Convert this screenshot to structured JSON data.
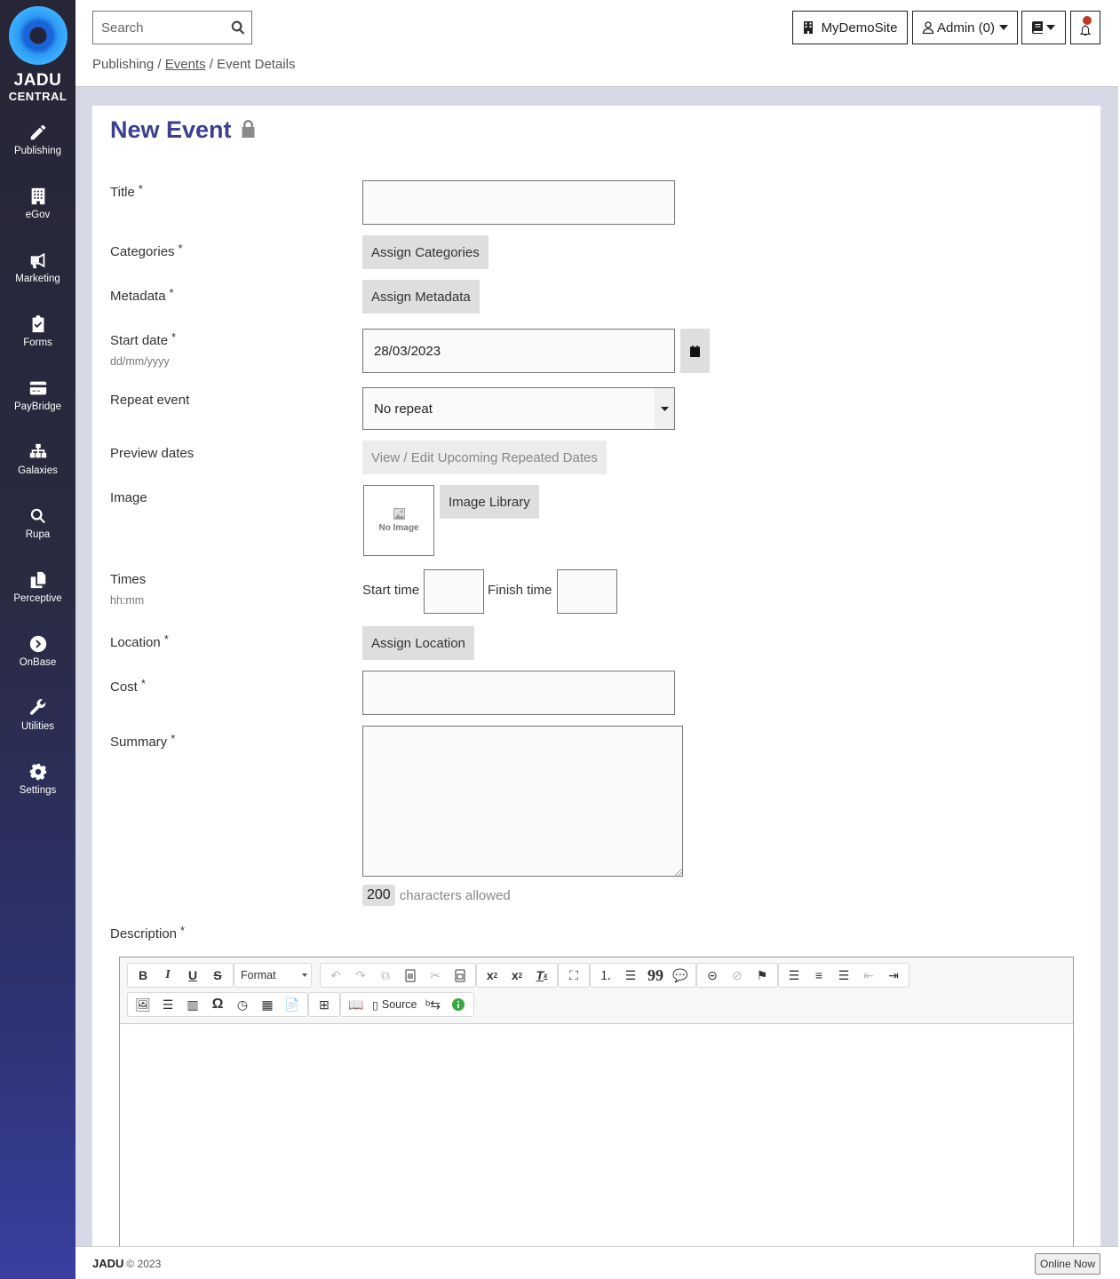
{
  "sidebar": {
    "logo_line1": "JADU",
    "logo_line2": "CENTRAL",
    "items": [
      {
        "label": "Publishing",
        "icon": "pencil-icon"
      },
      {
        "label": "eGov",
        "icon": "building-icon"
      },
      {
        "label": "Marketing",
        "icon": "megaphone-icon"
      },
      {
        "label": "Forms",
        "icon": "clipboard-check-icon"
      },
      {
        "label": "PayBridge",
        "icon": "credit-card-icon"
      },
      {
        "label": "Galaxies",
        "icon": "sitemap-icon"
      },
      {
        "label": "Rupa",
        "icon": "search-icon"
      },
      {
        "label": "Perceptive",
        "icon": "copy-icon"
      },
      {
        "label": "OnBase",
        "icon": "chevron-circle-right-icon"
      },
      {
        "label": "Utilities",
        "icon": "wrench-icon"
      },
      {
        "label": "Settings",
        "icon": "gear-icon"
      }
    ]
  },
  "header": {
    "search_placeholder": "Search",
    "breadcrumb": {
      "root": "Publishing",
      "sep": " / ",
      "link": "Events",
      "current": "Event Details"
    },
    "site_button": "MyDemoSite",
    "user_button": "Admin (0)",
    "notification_color": "#c0392b"
  },
  "form": {
    "title": "New Event",
    "required_marker": "*",
    "fields": {
      "title_label": "Title",
      "title_value": "",
      "categories_label": "Categories",
      "categories_button": "Assign Categories",
      "metadata_label": "Metadata",
      "metadata_button": "Assign Metadata",
      "start_date_label": "Start date",
      "start_date_hint": "dd/mm/yyyy",
      "start_date_value": "28/03/2023",
      "repeat_label": "Repeat event",
      "repeat_value": "No repeat",
      "preview_label": "Preview dates",
      "preview_button": "View / Edit Upcoming Repeated Dates",
      "image_label": "Image",
      "no_image_text": "No Image",
      "image_library_button": "Image Library",
      "times_label": "Times",
      "times_hint": "hh:mm",
      "start_time_label": "Start time",
      "start_time_value": "",
      "finish_time_label": "Finish time",
      "finish_time_value": "",
      "location_label": "Location",
      "location_button": "Assign Location",
      "cost_label": "Cost",
      "cost_value": "",
      "summary_label": "Summary",
      "summary_value": "",
      "summary_chars_allowed": "200",
      "summary_chars_text": "characters allowed",
      "description_label": "Description"
    }
  },
  "editor": {
    "format_label": "Format",
    "source_label": "Source",
    "bold": "B",
    "italic": "I",
    "underline": "U",
    "strike": "S",
    "special_char": "Ω"
  },
  "footer": {
    "brand": "JADU",
    "copyright": "© 2023",
    "online_button": "Online Now"
  },
  "colors": {
    "title": "#3d3f8f",
    "sidebar_bg": "#262637",
    "page_bg": "#d8d9e7"
  }
}
